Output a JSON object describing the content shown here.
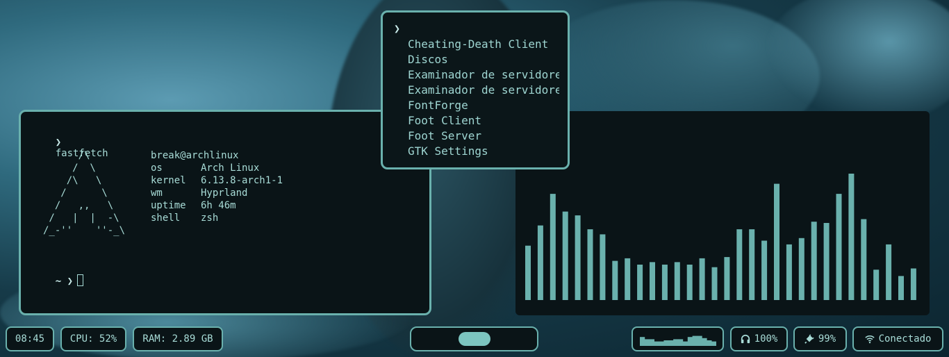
{
  "terminal": {
    "command_prompt": "❯",
    "command": "fastfetch",
    "ascii_art": "      /\\\n     /  \\\n    /\\   \\\n   /      \\\n  /   ,,   \\\n /   |  |  -\\\n/_-''    ''-_\\",
    "user_host": "break@archlinux",
    "info": [
      {
        "key": "os",
        "value": "Arch Linux"
      },
      {
        "key": "kernel",
        "value": "6.13.8-arch1-1"
      },
      {
        "key": "wm",
        "value": "Hyprland"
      },
      {
        "key": "uptime",
        "value": "6h 46m"
      },
      {
        "key": "shell",
        "value": "zsh"
      }
    ],
    "second_prompt": "~ ❯"
  },
  "launcher": {
    "prompt": "❯",
    "items": [
      "Cheating-Death Client",
      "Discos",
      "Examinador de servidores",
      "Examinador de servidores",
      "FontForge",
      "Foot Client",
      "Foot Server",
      "GTK Settings"
    ]
  },
  "visualizer": {
    "levels": [
      0.43,
      0.59,
      0.84,
      0.7,
      0.67,
      0.56,
      0.52,
      0.31,
      0.33,
      0.28,
      0.3,
      0.28,
      0.3,
      0.28,
      0.33,
      0.26,
      0.34,
      0.56,
      0.56,
      0.47,
      0.92,
      0.44,
      0.49,
      0.62,
      0.61,
      0.84,
      1.0,
      0.64,
      0.24,
      0.44,
      0.19,
      0.25
    ],
    "color": "#6ab1ad"
  },
  "statusbar": {
    "clock": "08:45",
    "cpu": "CPU: 52%",
    "ram": "RAM: 2.89 GB",
    "volume": "100%",
    "volume_icon": "headphones-icon",
    "battery": "99%",
    "battery_icon": "plug-icon",
    "network": "Conectado",
    "network_icon": "wifi-icon",
    "mini_graph_levels": [
      0.8,
      0.6,
      0.6,
      0.4,
      0.4,
      0.5,
      0.5,
      0.6,
      0.6,
      0.4,
      0.8,
      0.9,
      0.9,
      0.7,
      0.5,
      0.4
    ],
    "accent": "#6ab1ad"
  }
}
